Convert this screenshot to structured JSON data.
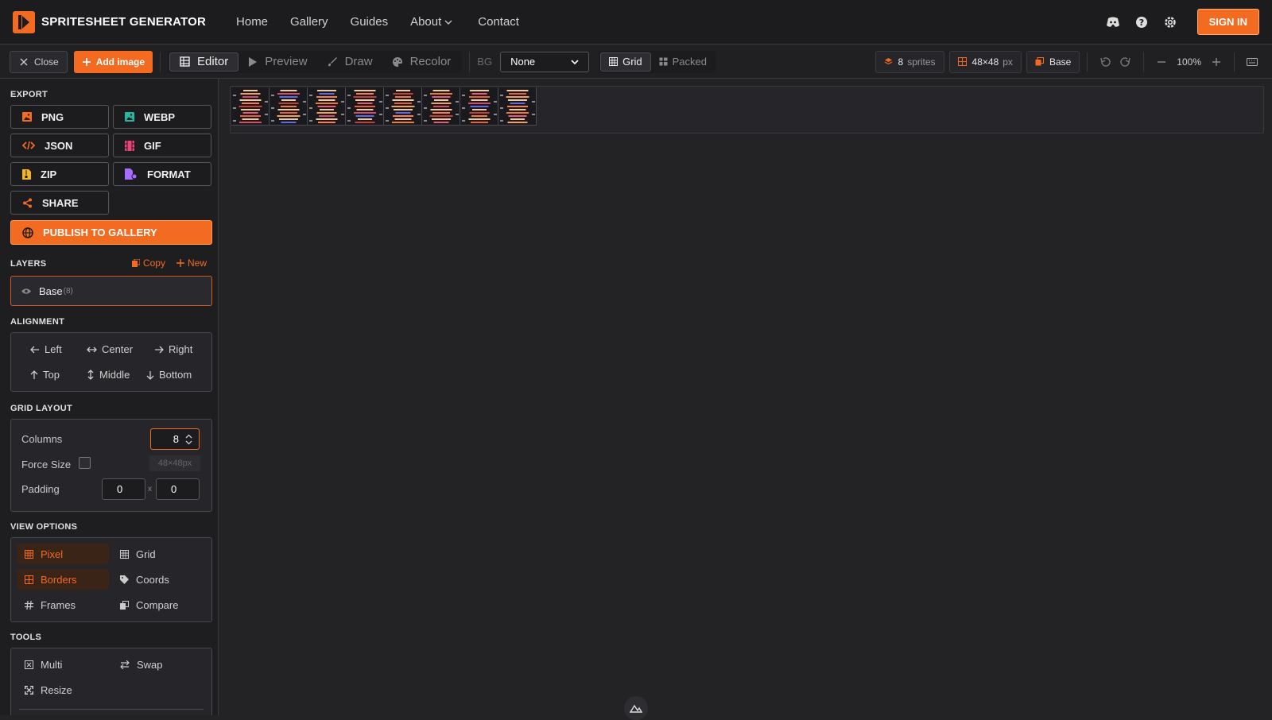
{
  "brand": {
    "name": "SPRITESHEET GENERATOR"
  },
  "nav": {
    "links": [
      "Home",
      "Gallery",
      "Guides",
      "About",
      "Contact"
    ],
    "signin": "SIGN IN"
  },
  "toolbar": {
    "close": "Close",
    "add_image": "Add image",
    "modes": [
      "Editor",
      "Preview",
      "Draw",
      "Recolor"
    ],
    "active_mode": "Editor",
    "bg_label": "BG",
    "bg_value": "None",
    "layouts": [
      "Grid",
      "Packed"
    ],
    "active_layout": "Grid",
    "sprite_count": "8",
    "sprite_count_label": "sprites",
    "sprite_size": "48×48",
    "sprite_size_unit": "px",
    "layer_name": "Base",
    "zoom": "100%"
  },
  "sidebar": {
    "export": {
      "title": "EXPORT",
      "buttons": [
        "PNG",
        "WEBP",
        "JSON",
        "GIF",
        "ZIP",
        "FORMAT",
        "SHARE"
      ],
      "publish": "PUBLISH TO GALLERY"
    },
    "layers": {
      "title": "LAYERS",
      "copy": "Copy",
      "new": "New",
      "items": [
        {
          "name": "Base",
          "count": "(8)"
        }
      ]
    },
    "alignment": {
      "title": "ALIGNMENT",
      "items": [
        "Left",
        "Center",
        "Right",
        "Top",
        "Middle",
        "Bottom"
      ]
    },
    "grid_layout": {
      "title": "GRID LAYOUT",
      "columns_label": "Columns",
      "columns_value": "8",
      "force_size_label": "Force Size",
      "force_size_checked": false,
      "force_size_value": "48×48px",
      "padding_label": "Padding",
      "padding_x": "0",
      "padding_sep": "x",
      "padding_y": "0"
    },
    "view_options": {
      "title": "VIEW OPTIONS",
      "items": [
        {
          "label": "Pixel",
          "on": true
        },
        {
          "label": "Grid",
          "on": false
        },
        {
          "label": "Borders",
          "on": true
        },
        {
          "label": "Coords",
          "on": false
        },
        {
          "label": "Frames",
          "on": false
        },
        {
          "label": "Compare",
          "on": false
        }
      ]
    },
    "tools": {
      "title": "TOOLS",
      "items": [
        "Multi",
        "Swap",
        "Resize"
      ]
    }
  },
  "colors": {
    "accent": "#f26b21",
    "bg": "#232326",
    "panel": "#26262a"
  }
}
